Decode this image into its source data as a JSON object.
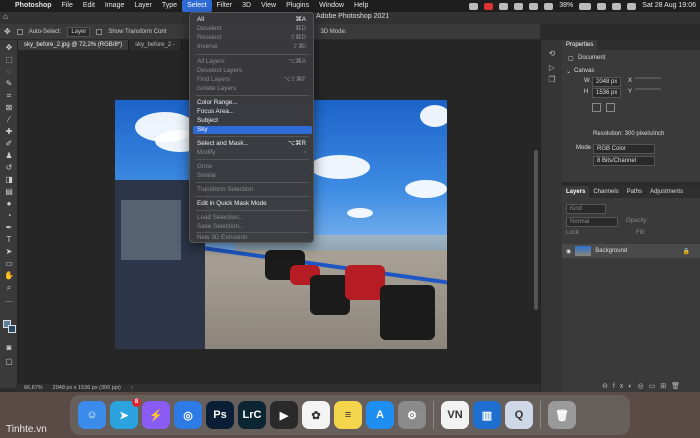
{
  "menubar": {
    "app": "Photoshop",
    "items": [
      "File",
      "Edit",
      "Image",
      "Layer",
      "Type",
      "Select",
      "Filter",
      "3D",
      "View",
      "Plugins",
      "Window",
      "Help"
    ],
    "active": "Select",
    "battery": "38%",
    "datetime": "Sat 28 Aug 19:06"
  },
  "window_title": "Adobe Photoshop 2021",
  "options_bar": {
    "auto_select_label": "Auto-Select:",
    "auto_select_value": "Layer",
    "show_transform_label": "Show Transform Cont",
    "mode_3d": "3D Mode:"
  },
  "tabs": [
    {
      "label": "sky_before_2.jpg @ 72,2% (RGB/8*)"
    },
    {
      "label": "sky_before_2 -"
    }
  ],
  "select_menu": {
    "items": [
      {
        "label": "All",
        "shortcut": "⌘A",
        "disabled": false
      },
      {
        "label": "Deselect",
        "shortcut": "⌘D",
        "disabled": true
      },
      {
        "label": "Reselect",
        "shortcut": "⇧⌘D",
        "disabled": true
      },
      {
        "label": "Inverse",
        "shortcut": "⇧⌘I",
        "disabled": true
      },
      {
        "label": "All Layers",
        "shortcut": "⌥⌘A",
        "disabled": true
      },
      {
        "label": "Deselect Layers",
        "shortcut": "",
        "disabled": true
      },
      {
        "label": "Find Layers",
        "shortcut": "⌥⇧⌘F",
        "disabled": true
      },
      {
        "label": "Isolate Layers",
        "shortcut": "",
        "disabled": true
      },
      {
        "label": "Color Range...",
        "shortcut": "",
        "disabled": false
      },
      {
        "label": "Focus Area...",
        "shortcut": "",
        "disabled": false
      },
      {
        "label": "Subject",
        "shortcut": "",
        "disabled": false
      },
      {
        "label": "Sky",
        "shortcut": "",
        "disabled": false
      },
      {
        "label": "Select and Mask...",
        "shortcut": "⌥⌘R",
        "disabled": false
      },
      {
        "label": "Modify",
        "shortcut": "›",
        "disabled": true
      },
      {
        "label": "Grow",
        "shortcut": "",
        "disabled": true
      },
      {
        "label": "Similar",
        "shortcut": "",
        "disabled": true
      },
      {
        "label": "Transform Selection",
        "shortcut": "",
        "disabled": true
      },
      {
        "label": "Edit in Quick Mask Mode",
        "shortcut": "",
        "disabled": false
      },
      {
        "label": "Load Selection...",
        "shortcut": "",
        "disabled": true
      },
      {
        "label": "Save Selection...",
        "shortcut": "",
        "disabled": true
      },
      {
        "label": "New 3D Extrusion",
        "shortcut": "",
        "disabled": true
      }
    ],
    "highlighted": "Sky"
  },
  "status_bar": {
    "zoom": "66,67%",
    "doc_info": "2048 px x 1536 px (300 ppi)"
  },
  "properties": {
    "title": "Properties",
    "subtitle": "Document",
    "section": "Canvas",
    "w_label": "W",
    "w_value": "2048 px",
    "h_label": "H",
    "h_value": "1536 px",
    "x_label": "X",
    "y_label": "Y",
    "resolution": "Resolution: 300 pixels/inch",
    "mode_label": "Mode",
    "mode_value": "RGB Color",
    "depth_value": "8 Bits/Channel"
  },
  "layers_panel": {
    "tabs": [
      "Layers",
      "Channels",
      "Paths",
      "Adjustments"
    ],
    "kind_label": "Kind",
    "blend_mode": "Normal",
    "opacity_label": "Opacity:",
    "lock_label": "Lock:",
    "fill_label": "Fill:",
    "layer_name": "Background"
  },
  "dock": {
    "apps": [
      {
        "name": "Finder",
        "color": "#3b8bea",
        "glyph": "☺"
      },
      {
        "name": "Telegram",
        "color": "#2aa3df",
        "glyph": "➤",
        "badge": "8"
      },
      {
        "name": "Messenger",
        "color": "#8a5cf5",
        "glyph": "⚡"
      },
      {
        "name": "Safari",
        "color": "#2f7be6",
        "glyph": "◎"
      },
      {
        "name": "Photoshop",
        "color": "#0a1f36",
        "glyph": "Ps"
      },
      {
        "name": "Lightroom Classic",
        "color": "#0c2533",
        "glyph": "LrC"
      },
      {
        "name": "Final Cut Pro",
        "color": "#2a2a2a",
        "glyph": "▶"
      },
      {
        "name": "Photos",
        "color": "#f4f4f4",
        "glyph": "✿"
      },
      {
        "name": "Notes",
        "color": "#f5d54b",
        "glyph": "≡"
      },
      {
        "name": "App Store",
        "color": "#1f8ef1",
        "glyph": "A"
      },
      {
        "name": "System Preferences",
        "color": "#8a8a8a",
        "glyph": "⚙"
      },
      {
        "name": "VN",
        "color": "#f2f2f2",
        "glyph": "VN"
      },
      {
        "name": "Trello",
        "color": "#1e6fd0",
        "glyph": "▥"
      },
      {
        "name": "QuickTime",
        "color": "#cfd8e6",
        "glyph": "Q"
      },
      {
        "name": "Trash",
        "color": "#9a9a9a",
        "glyph": "🗑"
      }
    ]
  },
  "watermark": "Tinhte.vn"
}
